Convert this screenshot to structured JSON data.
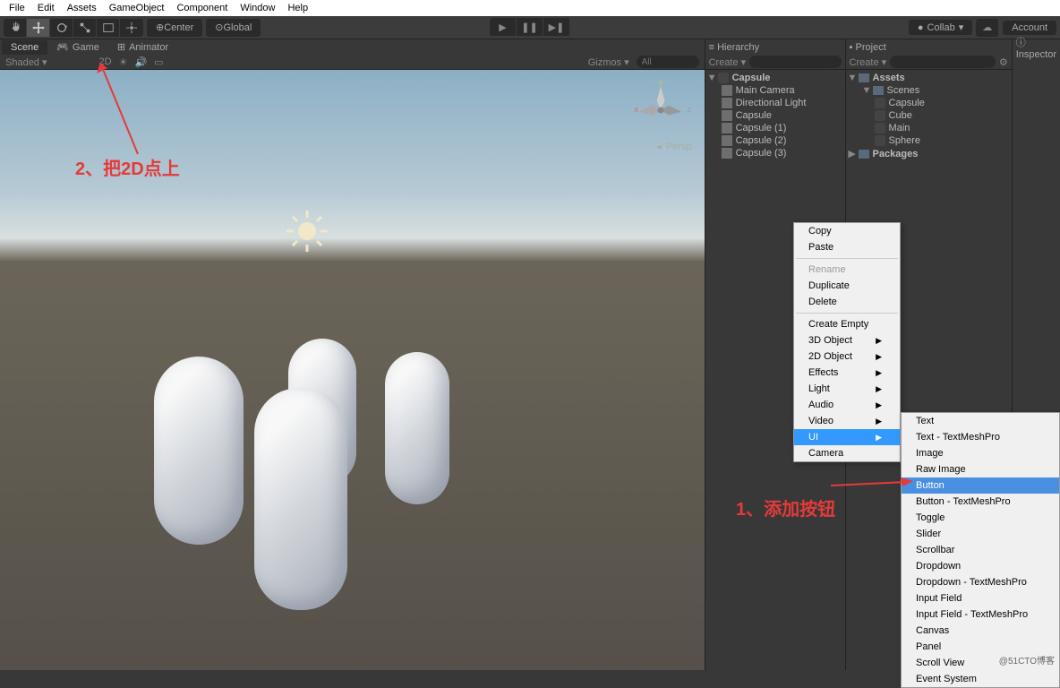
{
  "menubar": [
    "File",
    "Edit",
    "Assets",
    "GameObject",
    "Component",
    "Window",
    "Help"
  ],
  "toolbar": {
    "pivot": "Center",
    "space": "Global",
    "collab": "Collab",
    "account": "Account"
  },
  "tabs": {
    "scene": "Scene",
    "game": "Game",
    "animator": "Animator"
  },
  "scene_toolbar": {
    "shading": "Shaded",
    "mode2d": "2D",
    "gizmos": "Gizmos",
    "search_placeholder": "All"
  },
  "hierarchy": {
    "title": "Hierarchy",
    "create": "Create",
    "root": "Capsule",
    "items": [
      "Main Camera",
      "Directional Light",
      "Capsule",
      "Capsule (1)",
      "Capsule (2)",
      "Capsule (3)"
    ]
  },
  "project": {
    "title": "Project",
    "create": "Create",
    "assets": "Assets",
    "scenes": "Scenes",
    "scene_items": [
      "Capsule",
      "Cube",
      "Main",
      "Sphere"
    ],
    "packages": "Packages"
  },
  "inspector": {
    "title": "Inspector"
  },
  "context1": {
    "copy": "Copy",
    "paste": "Paste",
    "rename": "Rename",
    "duplicate": "Duplicate",
    "delete": "Delete",
    "create_empty": "Create Empty",
    "obj3d": "3D Object",
    "obj2d": "2D Object",
    "effects": "Effects",
    "light": "Light",
    "audio": "Audio",
    "video": "Video",
    "ui": "UI",
    "camera": "Camera"
  },
  "context2": {
    "items": [
      "Text",
      "Text - TextMeshPro",
      "Image",
      "Raw Image",
      "Button",
      "Button - TextMeshPro",
      "Toggle",
      "Slider",
      "Scrollbar",
      "Dropdown",
      "Dropdown - TextMeshPro",
      "Input Field",
      "Input Field - TextMeshPro",
      "Canvas",
      "Panel",
      "Scroll View",
      "Event System"
    ]
  },
  "annotations": {
    "a1": "2、把2D点上",
    "a2": "1、添加按钮"
  },
  "persp": "Persp",
  "watermark": "@51CTO博客"
}
